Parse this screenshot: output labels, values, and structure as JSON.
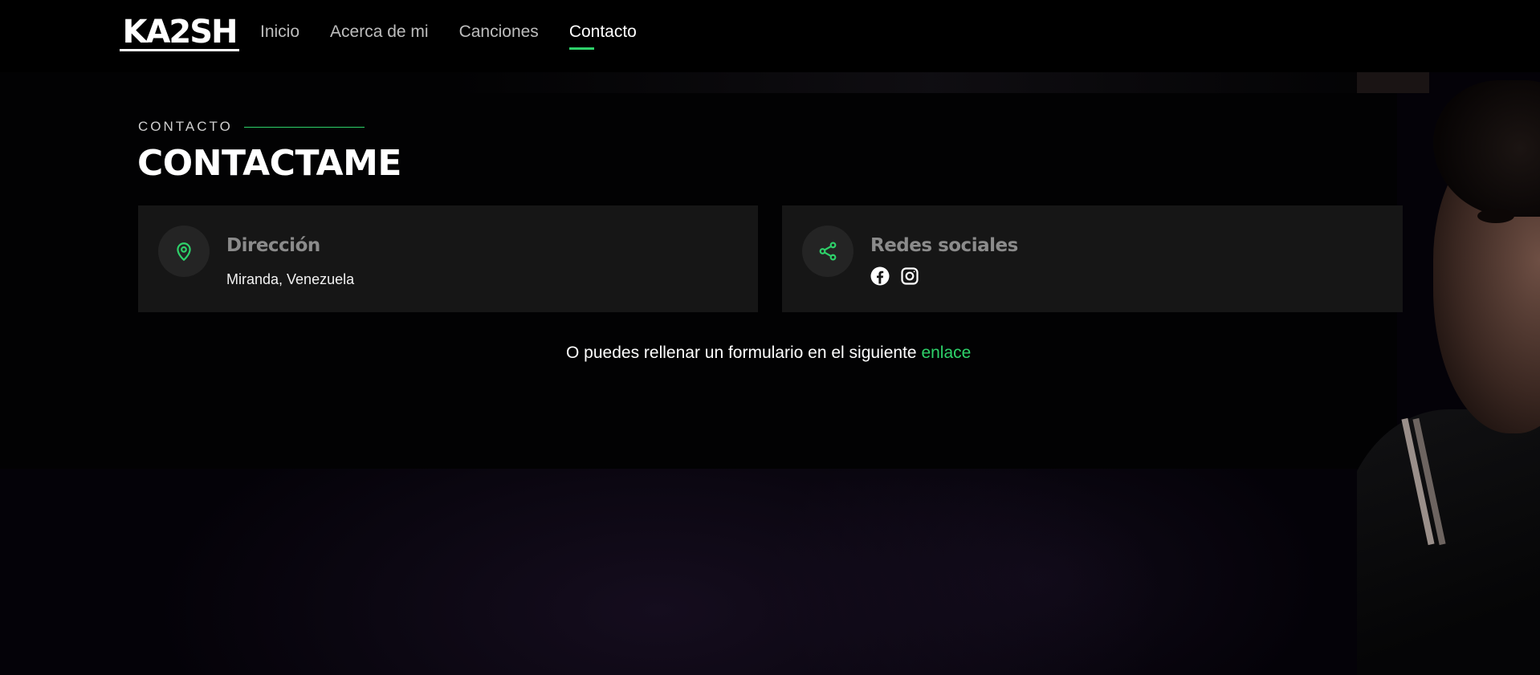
{
  "brand": {
    "logo_text": "KA2SH",
    "accent": "#2ed26a"
  },
  "nav": {
    "items": [
      {
        "label": "Inicio",
        "active": false
      },
      {
        "label": "Acerca de mi",
        "active": false
      },
      {
        "label": "Canciones",
        "active": false
      },
      {
        "label": "Contacto",
        "active": true
      }
    ]
  },
  "section": {
    "eyebrow": "CONTACTO",
    "title": "CONTACTAME"
  },
  "cards": {
    "address": {
      "icon": "map-pin-icon",
      "title": "Dirección",
      "text": "Miranda, Venezuela"
    },
    "social": {
      "icon": "share-icon",
      "title": "Redes sociales",
      "links": [
        "facebook-icon",
        "instagram-icon"
      ]
    }
  },
  "footer": {
    "text": "O puedes rellenar un formulario en el siguiente ",
    "link_label": "enlace"
  }
}
